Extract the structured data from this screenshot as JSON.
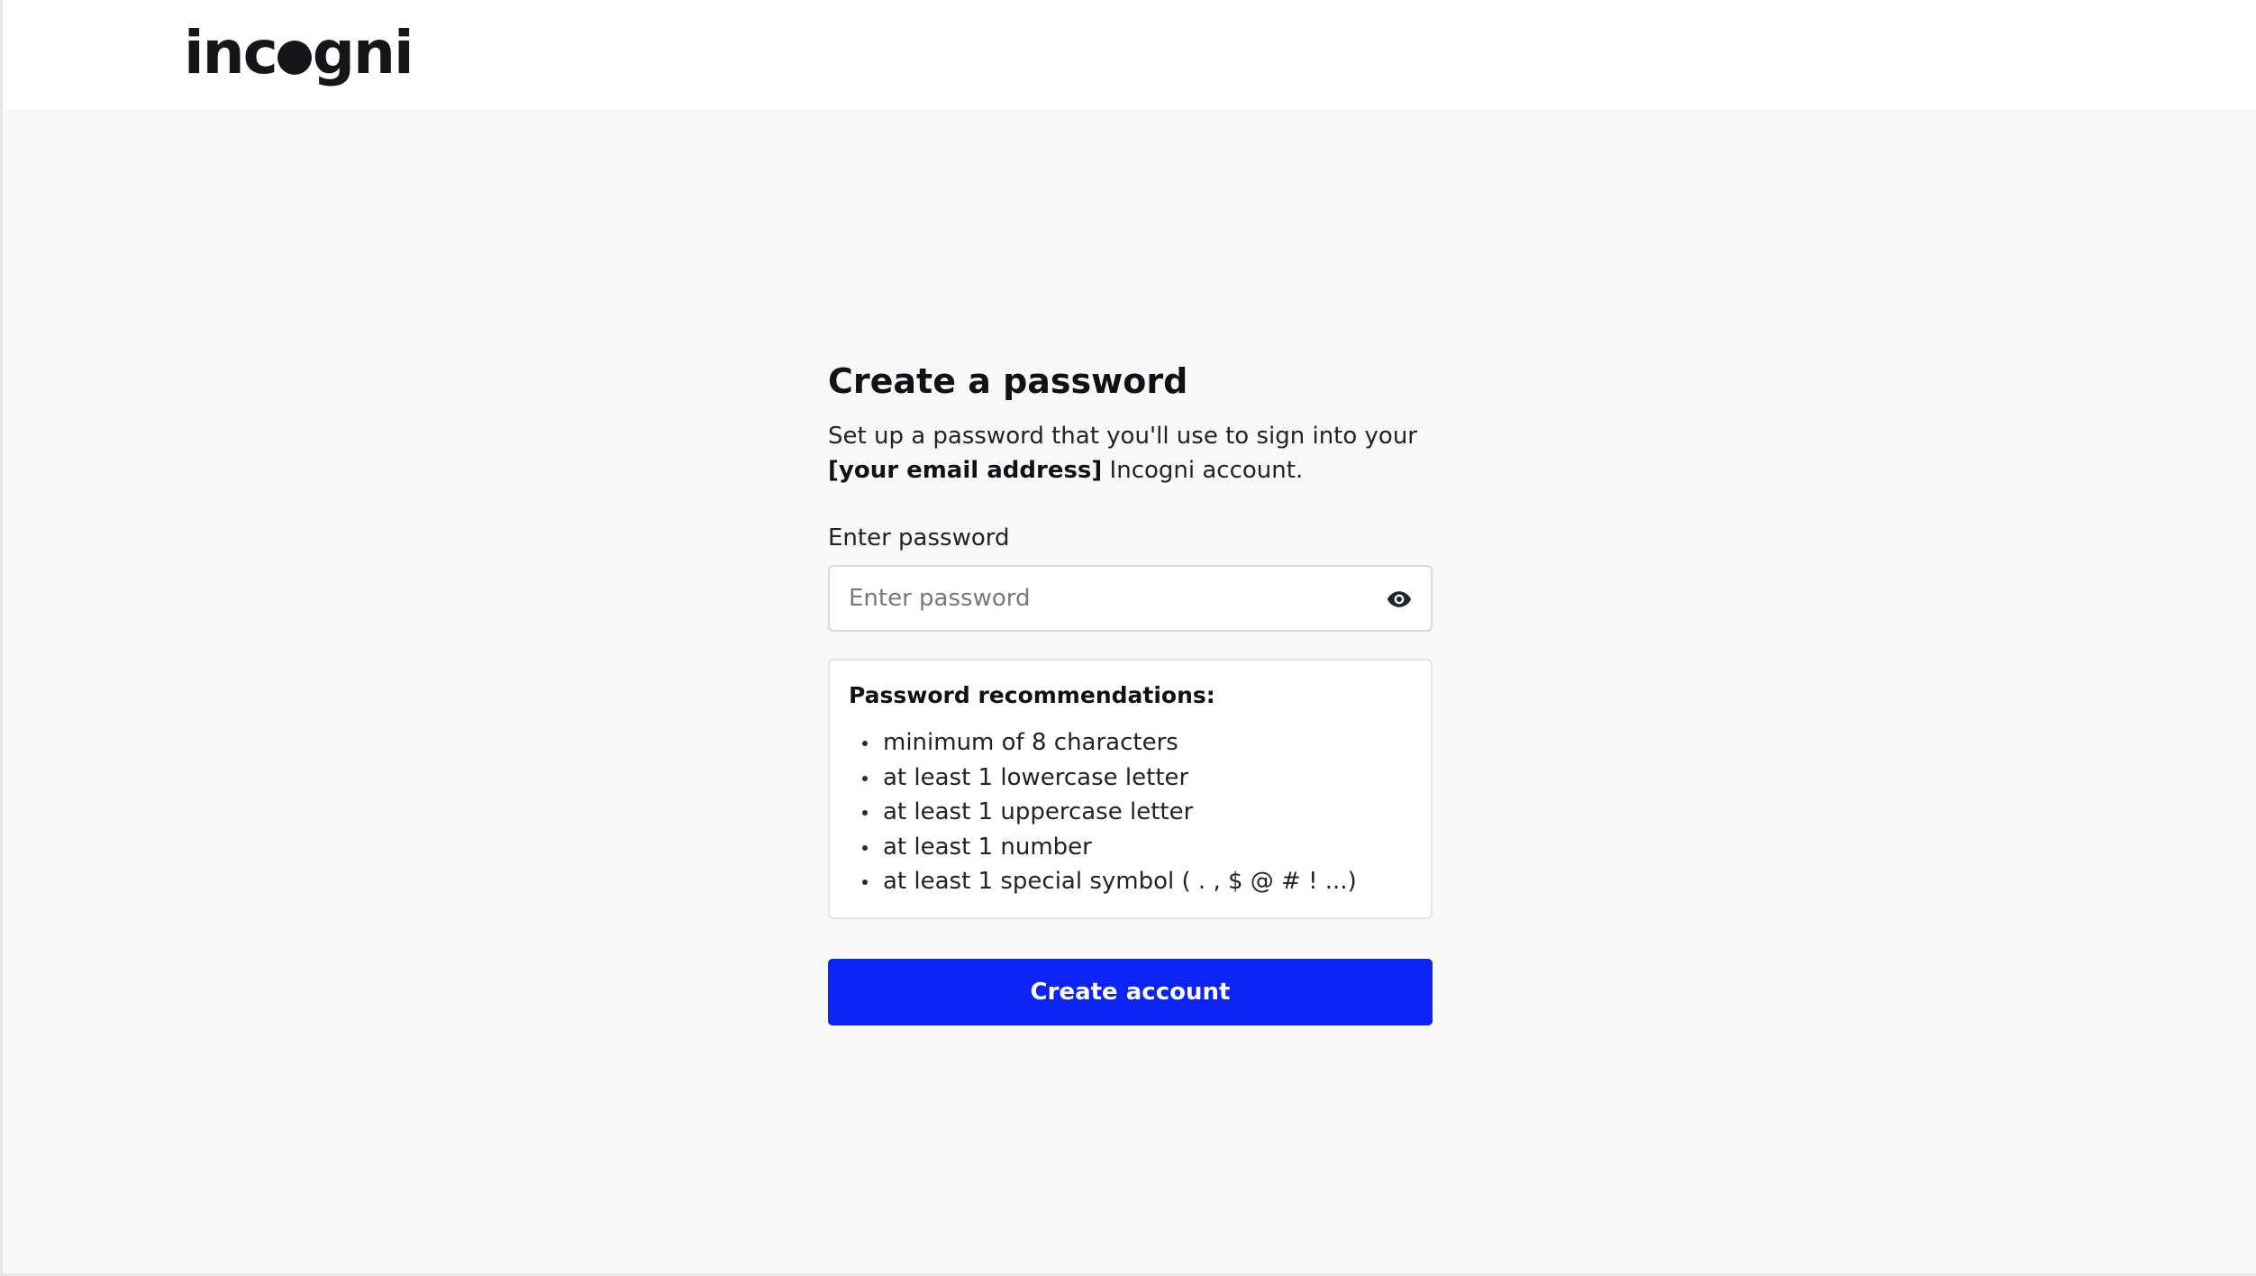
{
  "header": {
    "logo": {
      "text_before": "inc",
      "text_after": "gni"
    }
  },
  "form": {
    "title": "Create a password",
    "description": {
      "part1": "Set up a password that you'll use to sign into your ",
      "emphasis": "[your email address]",
      "part2": " Incogni account."
    },
    "password_label": "Enter password",
    "password_placeholder": "Enter password",
    "password_value": "",
    "visibility_toggle_icon": "eye-icon",
    "recommendations": {
      "title": "Password recommendations:",
      "items": [
        "minimum of 8 characters",
        "at least 1 lowercase letter",
        "at least 1 uppercase letter",
        "at least 1 number",
        "at least 1 special symbol ( . , $ @ # ! ...)"
      ]
    },
    "submit_label": "Create account"
  },
  "colors": {
    "accent": "#0b24f5",
    "page_background": "#f8f8f8",
    "header_background": "#ffffff",
    "text": "#1b1b1f"
  }
}
